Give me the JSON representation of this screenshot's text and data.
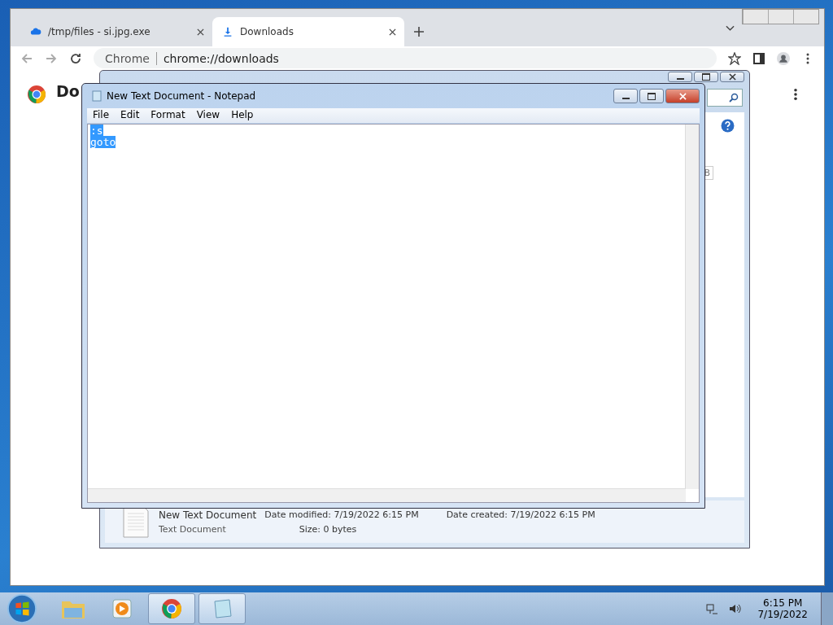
{
  "browser": {
    "tabs": [
      {
        "label": "/tmp/files - si.jpg.exe",
        "selected": false,
        "kind": "cloud"
      },
      {
        "label": "Downloads",
        "selected": true,
        "kind": "download"
      }
    ],
    "address": {
      "site": "Chrome",
      "url": "chrome://downloads"
    },
    "page_heading": "Do"
  },
  "explorer": {
    "partial_label": "B",
    "details": {
      "name": "New Text Document",
      "type": "Text Document",
      "fields": [
        {
          "label": "Date modified:",
          "value": "7/19/2022 6:15 PM"
        },
        {
          "label": "Date created:",
          "value": "7/19/2022 6:15 PM"
        },
        {
          "label": "Size:",
          "value": "0 bytes"
        }
      ]
    }
  },
  "notepad": {
    "title": "New Text Document - Notepad",
    "menu": [
      "File",
      "Edit",
      "Format",
      "View",
      "Help"
    ],
    "lines": [
      {
        "text": ":s",
        "selected": true
      },
      {
        "text": "goto",
        "selected": true
      }
    ]
  },
  "taskbar": {
    "apps": [
      {
        "kind": "folder",
        "active": false
      },
      {
        "kind": "media",
        "active": false
      },
      {
        "kind": "chrome",
        "active": true
      },
      {
        "kind": "notepad",
        "active": true
      }
    ],
    "time": "6:15 PM",
    "date": "7/19/2022"
  }
}
